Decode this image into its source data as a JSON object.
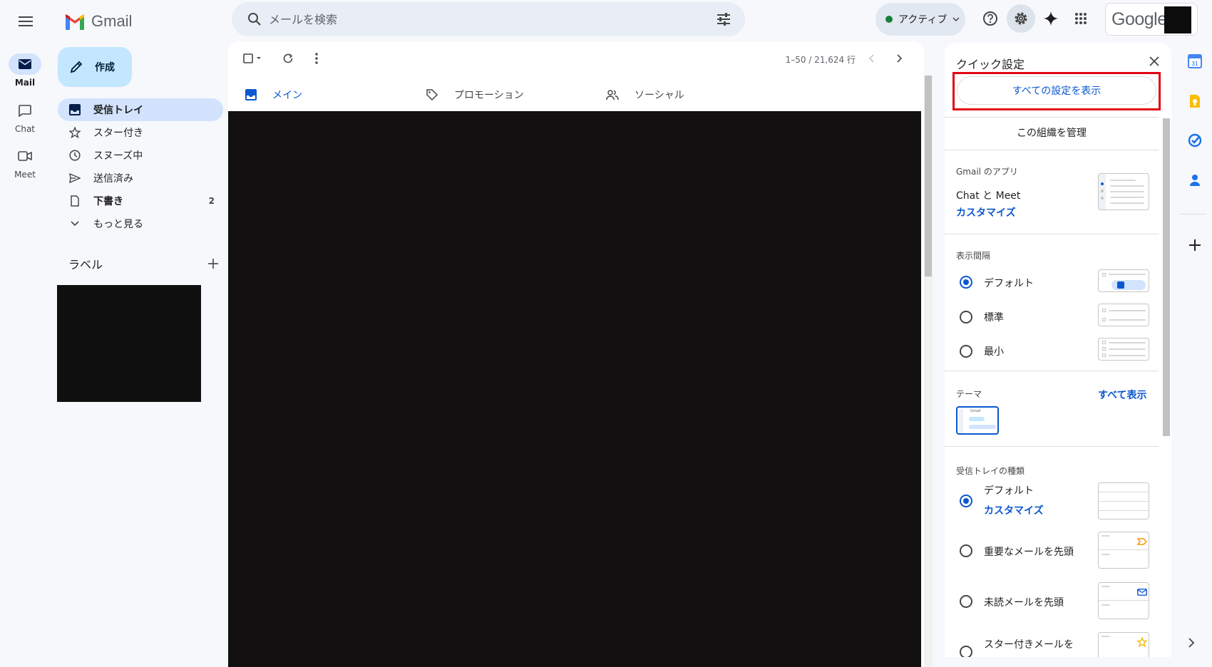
{
  "app": {
    "name": "Gmail",
    "account_brand": "Google"
  },
  "search": {
    "placeholder": "メールを検索",
    "value": ""
  },
  "status": {
    "label": "アクティブ",
    "color": "#188038"
  },
  "rail": [
    {
      "label": "Mail",
      "icon": "mail-icon"
    },
    {
      "label": "Chat",
      "icon": "chat-icon"
    },
    {
      "label": "Meet",
      "icon": "video-icon"
    }
  ],
  "compose": {
    "label": "作成"
  },
  "nav": [
    {
      "label": "受信トレイ",
      "icon": "inbox-icon",
      "count": ""
    },
    {
      "label": "スター付き",
      "icon": "star-icon",
      "count": ""
    },
    {
      "label": "スヌーズ中",
      "icon": "clock-icon",
      "count": ""
    },
    {
      "label": "送信済み",
      "icon": "send-icon",
      "count": ""
    },
    {
      "label": "下書き",
      "icon": "draft-icon",
      "count": "2"
    },
    {
      "label": "もっと見る",
      "icon": "chevron-down-icon",
      "count": ""
    }
  ],
  "labels": {
    "title": "ラベル"
  },
  "toolbar": {
    "pager": "1–50 / 21,624 行"
  },
  "tabs": [
    {
      "label": "メイン",
      "icon": "inbox-icon"
    },
    {
      "label": "プロモーション",
      "icon": "tag-icon"
    },
    {
      "label": "ソーシャル",
      "icon": "people-icon"
    }
  ],
  "quick_settings": {
    "title": "クイック設定",
    "all_settings": "すべての設定を表示",
    "manage_org": "この組織を管理",
    "apps": {
      "section": "Gmail のアプリ",
      "label": "Chat と Meet",
      "link": "カスタマイズ"
    },
    "density": {
      "section": "表示間隔",
      "options": [
        "デフォルト",
        "標準",
        "最小"
      ],
      "selected": "デフォルト"
    },
    "theme": {
      "section": "テーマ",
      "link": "すべて表示",
      "thumb_text": "Gmail"
    },
    "inbox_type": {
      "section": "受信トレイの種類",
      "options": [
        "デフォルト",
        "重要なメールを先頭",
        "未読メールを先頭",
        "スター付きメールを"
      ],
      "customize": "カスタマイズ",
      "selected": "デフォルト"
    }
  },
  "side_panel": {
    "calendar_day": "31",
    "apps": [
      "calendar-icon",
      "keep-icon",
      "tasks-icon",
      "contacts-icon"
    ]
  },
  "colors": {
    "accent": "#0b57d0",
    "highlight": "#e30613",
    "compose": "#c2e7ff",
    "active_nav": "#d3e3fd"
  }
}
